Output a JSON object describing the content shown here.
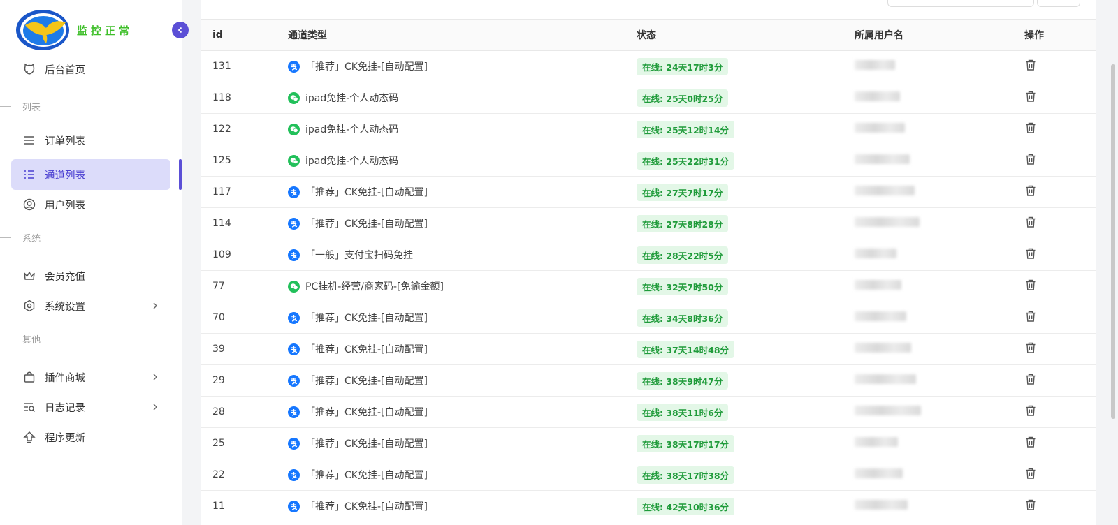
{
  "brand": {
    "text": "监控正常"
  },
  "nav": {
    "home": "后台首页",
    "section_list": "列表",
    "orders": "订单列表",
    "channels": "通道列表",
    "users": "用户列表",
    "section_system": "系统",
    "recharge": "会员充值",
    "settings": "系统设置",
    "section_other": "其他",
    "plugins": "插件商城",
    "logs": "日志记录",
    "update": "程序更新"
  },
  "table": {
    "headers": {
      "id": "id",
      "type": "通道类型",
      "status": "状态",
      "user": "所属用户名",
      "op": "操作"
    },
    "rows": [
      {
        "id": "131",
        "icon": "alipay",
        "type": "「推荐」CK免挂-[自动配置]",
        "status": "在线: 24天17时3分"
      },
      {
        "id": "118",
        "icon": "wechat",
        "type": "ipad免挂-个人动态码",
        "status": "在线: 25天0时25分"
      },
      {
        "id": "122",
        "icon": "wechat",
        "type": "ipad免挂-个人动态码",
        "status": "在线: 25天12时14分"
      },
      {
        "id": "125",
        "icon": "wechat",
        "type": "ipad免挂-个人动态码",
        "status": "在线: 25天22时31分"
      },
      {
        "id": "117",
        "icon": "alipay",
        "type": "「推荐」CK免挂-[自动配置]",
        "status": "在线: 27天7时17分"
      },
      {
        "id": "114",
        "icon": "alipay",
        "type": "「推荐」CK免挂-[自动配置]",
        "status": "在线: 27天8时28分"
      },
      {
        "id": "109",
        "icon": "alipay",
        "type": "「一般」支付宝扫码免挂",
        "status": "在线: 28天22时5分"
      },
      {
        "id": "77",
        "icon": "wechat",
        "type": "PC挂机-经营/商家码-[免输金额]",
        "status": "在线: 32天7时50分"
      },
      {
        "id": "70",
        "icon": "alipay",
        "type": "「推荐」CK免挂-[自动配置]",
        "status": "在线: 34天8时36分"
      },
      {
        "id": "39",
        "icon": "alipay",
        "type": "「推荐」CK免挂-[自动配置]",
        "status": "在线: 37天14时48分"
      },
      {
        "id": "29",
        "icon": "alipay",
        "type": "「推荐」CK免挂-[自动配置]",
        "status": "在线: 38天9时47分"
      },
      {
        "id": "28",
        "icon": "alipay",
        "type": "「推荐」CK免挂-[自动配置]",
        "status": "在线: 38天11时6分"
      },
      {
        "id": "25",
        "icon": "alipay",
        "type": "「推荐」CK免挂-[自动配置]",
        "status": "在线: 38天17时17分"
      },
      {
        "id": "22",
        "icon": "alipay",
        "type": "「推荐」CK免挂-[自动配置]",
        "status": "在线: 38天17时38分"
      },
      {
        "id": "11",
        "icon": "alipay",
        "type": "「推荐」CK免挂-[自动配置]",
        "status": "在线: 42天10时36分"
      }
    ]
  },
  "colors": {
    "accent": "#5b4fd6",
    "active_bg": "#dcdcfa",
    "online_bg": "#e3f7e7",
    "online_text": "#1f9b3a",
    "brand_green": "#3fbf2a"
  }
}
